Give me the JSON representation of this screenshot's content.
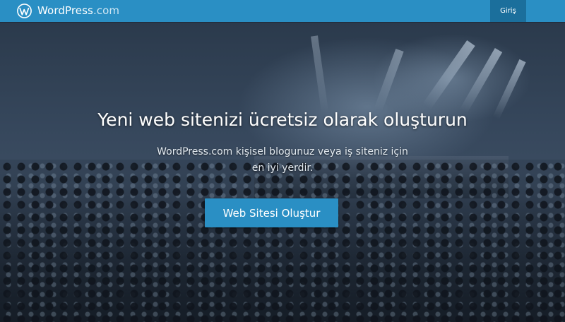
{
  "header": {
    "brand_word": "WordPress",
    "brand_tld": ".com",
    "login_label": "Giriş",
    "bar_color": "#2a8fc4",
    "login_bg": "#1b6f9c",
    "logo_icon": "wordpress-logo-icon"
  },
  "hero": {
    "title": "Yeni web sitenizi ücretsiz olarak oluşturun",
    "subtitle_line1": "WordPress.com kişisel blogunuz veya iş siteniz için",
    "subtitle_line2": "en iyi yerdir.",
    "cta_label": "Web Sitesi Oluştur",
    "cta_color": "#2a8fc4",
    "background_image": "concert-crowd-photo"
  }
}
